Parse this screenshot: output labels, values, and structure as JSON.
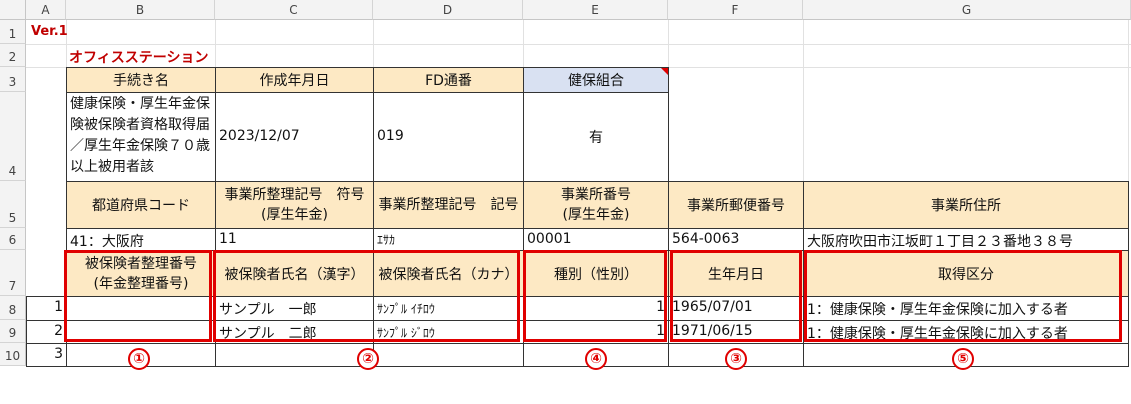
{
  "columns": [
    "A",
    "B",
    "C",
    "D",
    "E",
    "F",
    "G"
  ],
  "rows": [
    "1",
    "2",
    "3",
    "4",
    "5",
    "6",
    "7",
    "8",
    "9",
    "10"
  ],
  "version": "Ver.1",
  "office_title": "オフィスステーション",
  "header_row3": {
    "procedure_name": "手続き名",
    "created_date": "作成年月日",
    "fd_number": "FD通番",
    "kenpo_kumiai": "健保組合"
  },
  "row4": {
    "procedure_value": "健康保険・厚生年金保険被保険者資格取得届／厚生年金保険７０歳以上被用者該",
    "created_date_value": "2023/12/07",
    "fd_number_value": "019",
    "kenpo_value": "有"
  },
  "header_row5": {
    "pref_code": "都道府県コード",
    "office_code_symbol": "事業所整理記号　符号\n(厚生年金)",
    "office_code_mark": "事業所整理記号　記号",
    "office_number": "事業所番号\n(厚生年金)",
    "office_postal": "事業所郵便番号",
    "office_address": "事業所住所"
  },
  "row6": {
    "pref_value": "41：大阪府",
    "symbol_value": "11",
    "mark_value": "ｴｻｶ",
    "office_number_value": "00001",
    "postal_value": "564-0063",
    "address_value": "大阪府吹田市江坂町１丁目２３番地３８号"
  },
  "header_row7": {
    "insured_number": "被保険者整理番号\n(年金整理番号)",
    "name_kanji": "被保険者氏名（漢字）",
    "name_kana": "被保険者氏名（カナ）",
    "type_gender": "種別（性別）",
    "birth_date": "生年月日",
    "acquisition_type": "取得区分"
  },
  "data_rows": [
    {
      "no": "1",
      "name_kanji": "サンプル　一郎",
      "name_kana": "ｻﾝﾌﾟﾙ ｲﾁﾛｳ",
      "type": "1",
      "birth": "1965/07/01",
      "acq": "1：健康保険・厚生年金保険に加入する者"
    },
    {
      "no": "2",
      "name_kanji": "サンプル　二郎",
      "name_kana": "ｻﾝﾌﾟﾙ ｼﾞﾛｳ",
      "type": "1",
      "birth": "1971/06/15",
      "acq": "1：健康保険・厚生年金保険に加入する者"
    },
    {
      "no": "3"
    }
  ],
  "callouts": [
    "①",
    "②",
    "④",
    "③",
    "⑤"
  ]
}
